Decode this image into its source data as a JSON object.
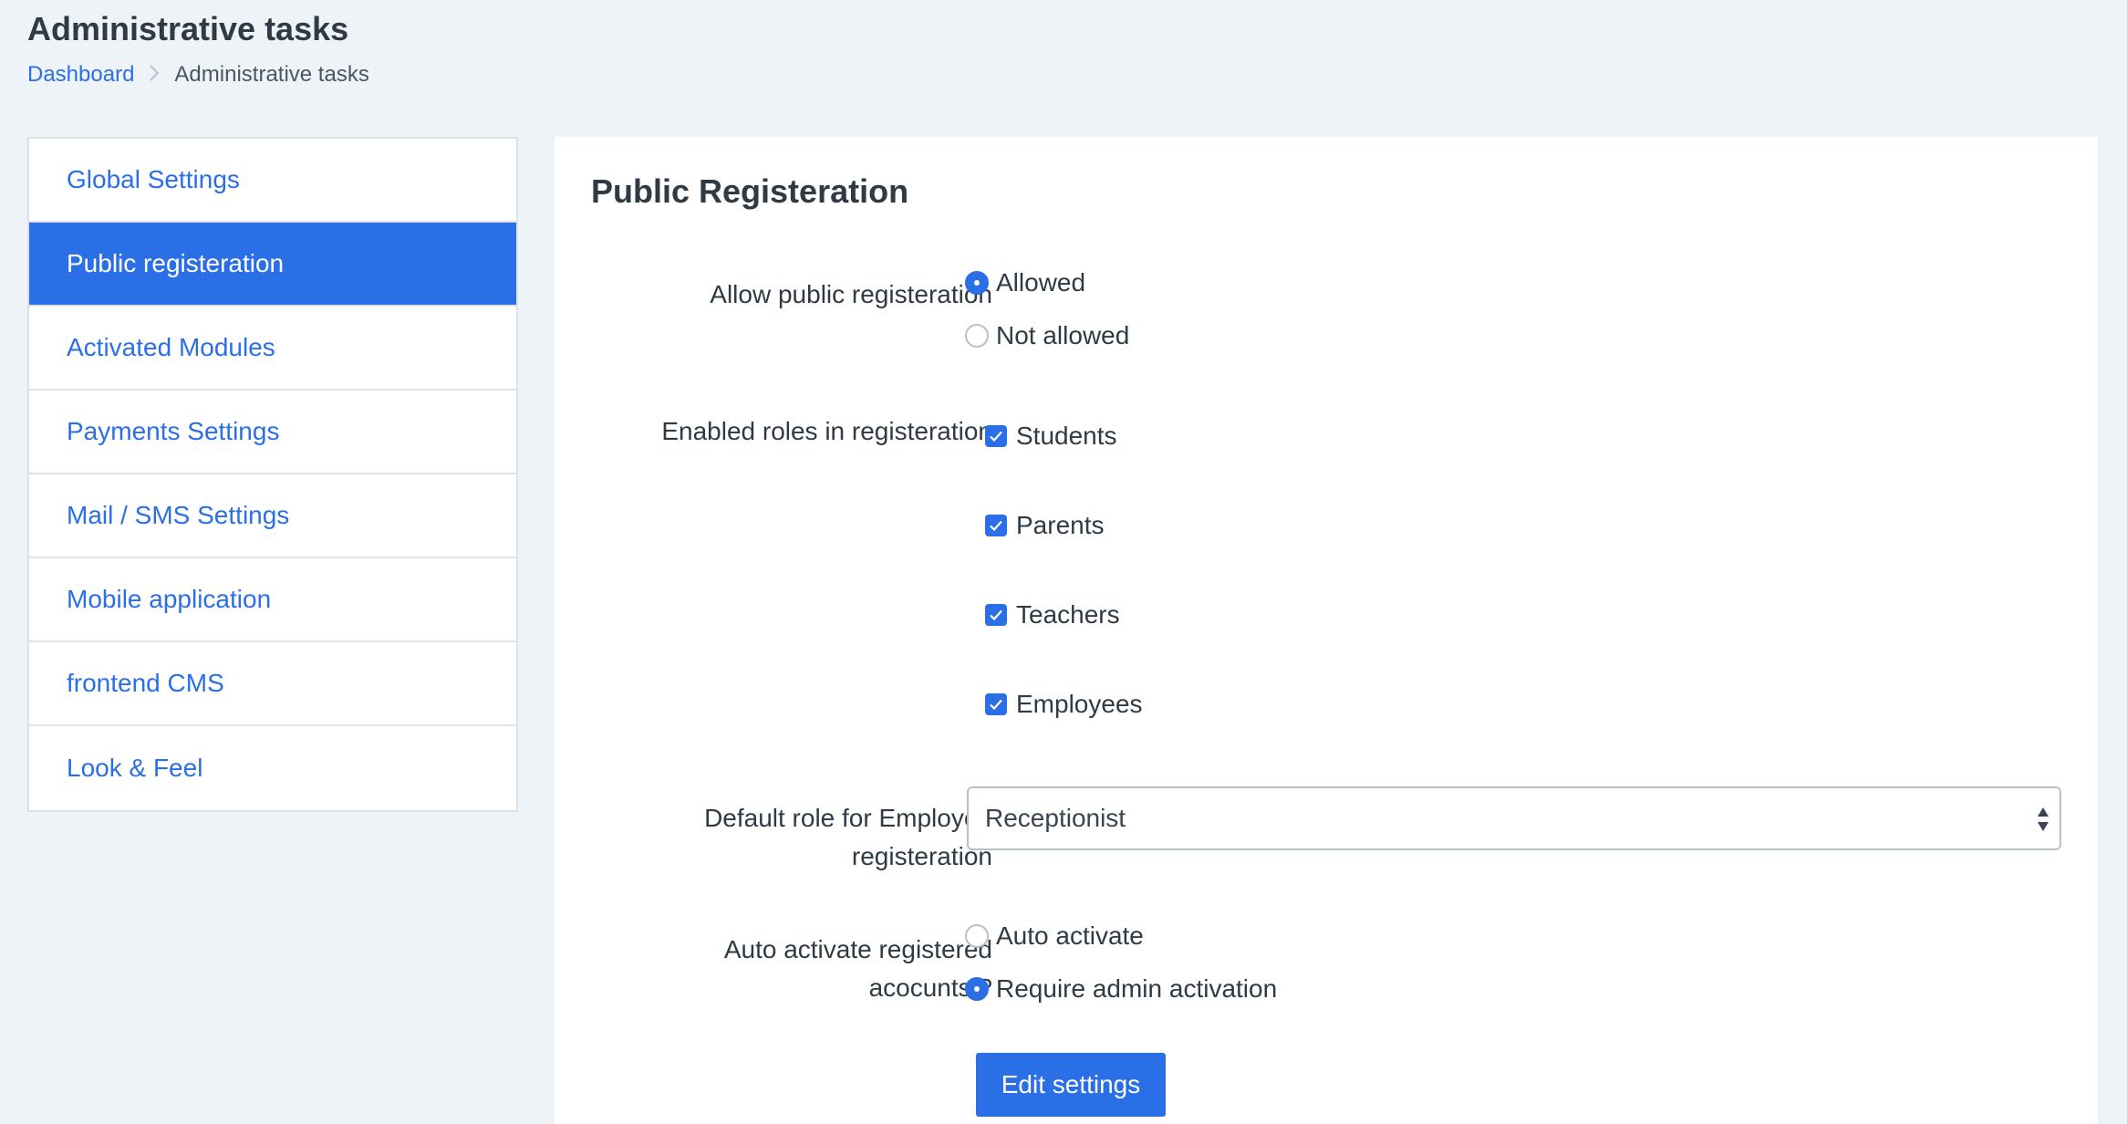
{
  "header": {
    "title": "Administrative tasks",
    "breadcrumb": {
      "home": "Dashboard",
      "separator": ">",
      "current": "Administrative tasks"
    }
  },
  "sidebar": {
    "items": [
      {
        "label": "Global Settings",
        "active": false
      },
      {
        "label": "Public registeration",
        "active": true
      },
      {
        "label": "Activated Modules",
        "active": false
      },
      {
        "label": "Payments Settings",
        "active": false
      },
      {
        "label": "Mail / SMS Settings",
        "active": false
      },
      {
        "label": "Mobile application",
        "active": false
      },
      {
        "label": "frontend CMS",
        "active": false
      },
      {
        "label": "Look & Feel",
        "active": false
      }
    ]
  },
  "main": {
    "title": "Public Registeration",
    "allow_registration": {
      "label": "Allow public registeration",
      "options": [
        {
          "label": "Allowed",
          "checked": true
        },
        {
          "label": "Not allowed",
          "checked": false
        }
      ]
    },
    "enabled_roles": {
      "label": "Enabled roles in registeration",
      "options": [
        {
          "label": "Students",
          "checked": true
        },
        {
          "label": "Parents",
          "checked": true
        },
        {
          "label": "Teachers",
          "checked": true
        },
        {
          "label": "Employees",
          "checked": true
        }
      ]
    },
    "default_role": {
      "label_line1": "Default role for Employee",
      "label_line2": "registeration",
      "value": "Receptionist"
    },
    "auto_activate": {
      "label_line1": "Auto activate registered",
      "label_line2": "acocunts ?",
      "options": [
        {
          "label": "Auto activate",
          "checked": false
        },
        {
          "label": "Require admin activation",
          "checked": true
        }
      ]
    },
    "submit_label": "Edit settings"
  },
  "colors": {
    "accent": "#2b6fe6",
    "background": "#eef3f7",
    "text": "#2f3a45"
  }
}
